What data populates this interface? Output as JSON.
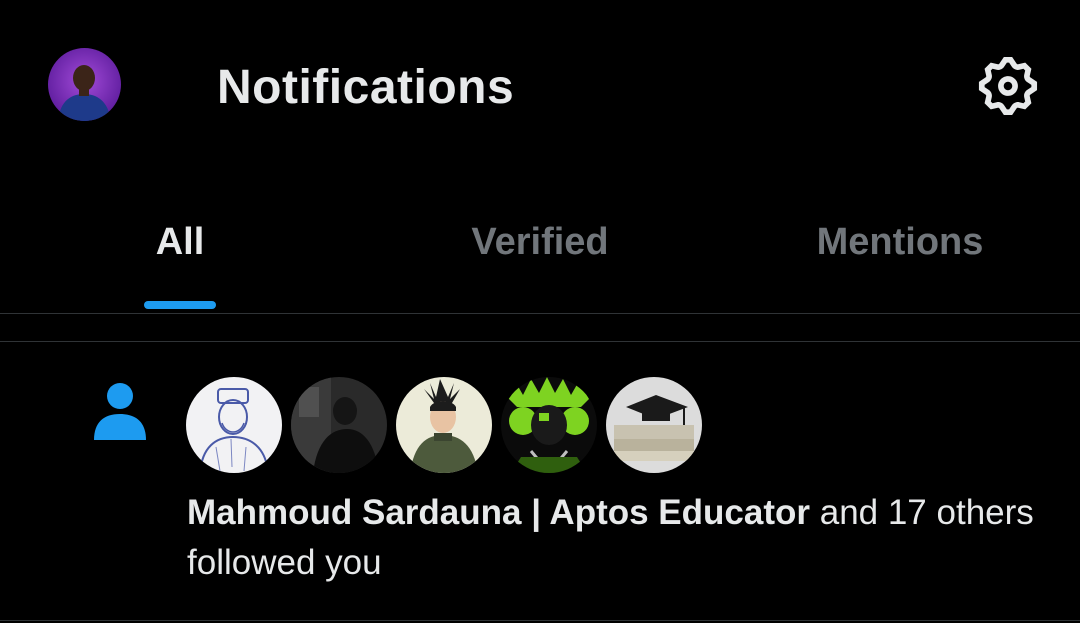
{
  "header": {
    "title": "Notifications",
    "avatar_icon": "profile-avatar",
    "settings_icon": "gear-icon"
  },
  "tabs": [
    {
      "label": "All",
      "active": true
    },
    {
      "label": "Verified",
      "active": false
    },
    {
      "label": "Mentions",
      "active": false
    }
  ],
  "notification": {
    "type_icon": "person-icon",
    "name": "Mahmoud Sardauna | Aptos Educator",
    "suffix": " and 17 others followed you",
    "avatars": [
      "avatar-sketch",
      "avatar-dark-photo",
      "avatar-anime-character",
      "avatar-green-monster",
      "avatar-graduation-cap"
    ]
  },
  "colors": {
    "background": "#000000",
    "accent": "#1d9bf0",
    "text_primary": "#e7e9ea",
    "text_secondary": "#71767b",
    "divider": "#2f3336"
  }
}
